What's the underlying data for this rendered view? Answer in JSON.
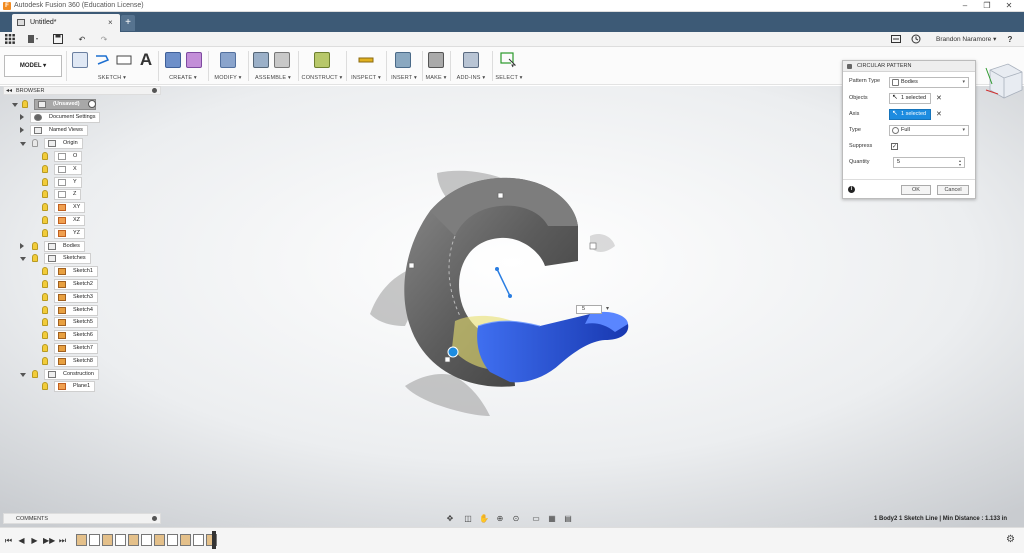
{
  "window": {
    "title": "Autodesk Fusion 360 (Education License)",
    "logo": "F",
    "controls": [
      "–",
      "❐",
      "✕"
    ]
  },
  "tab": {
    "label": "Untitled*",
    "close": "×",
    "plus": "+"
  },
  "qat": {
    "undo": "↶",
    "redo": "↷",
    "save": "💾",
    "user": "Brandon Naramore ▾",
    "help": "?"
  },
  "toolbar": {
    "model_label": "MODEL ▾",
    "groups": [
      "SKETCH ▾",
      "CREATE ▾",
      "MODIFY ▾",
      "ASSEMBLE ▾",
      "CONSTRUCT ▾",
      "INSPECT ▾",
      "INSERT ▾",
      "MAKE ▾",
      "ADD-INS ▾",
      "SELECT ▾"
    ]
  },
  "browser": {
    "title": "BROWSER",
    "root": "(Unsaved)",
    "items": {
      "document_settings": "Document Settings",
      "named_views": "Named Views",
      "origin": "Origin",
      "o": "O",
      "x": "X",
      "y": "Y",
      "z": "Z",
      "xy": "XY",
      "xz": "XZ",
      "yz": "YZ",
      "bodies": "Bodies",
      "sketches": "Sketches",
      "sketch1": "Sketch1",
      "sketch2": "Sketch2",
      "sketch3": "Sketch3",
      "sketch4": "Sketch4",
      "sketch5": "Sketch5",
      "sketch6": "Sketch6",
      "sketch7": "Sketch7",
      "sketch8": "Sketch8",
      "construction": "Construction",
      "plane1": "Plane1"
    }
  },
  "comments": {
    "title": "COMMENTS"
  },
  "dialog": {
    "title": "CIRCULAR PATTERN",
    "pattern_type_label": "Pattern Type",
    "pattern_type_value": "Bodies",
    "objects_label": "Objects",
    "objects_value": "1 selected",
    "axis_label": "Axis",
    "axis_value": "1 selected",
    "type_label": "Type",
    "type_value": "Full",
    "suppress_label": "Suppress",
    "suppress_checked": "✓",
    "quantity_label": "Quantity",
    "quantity_value": "5",
    "info": "i",
    "ok": "OK",
    "cancel": "Cancel"
  },
  "canvas": {
    "quantity_input": "5"
  },
  "status": {
    "text": "1 Body2 1 Sketch Line | Min Distance : 1.133 in"
  },
  "timeline": {
    "controls": [
      "⏮",
      "◀",
      "▶",
      "▶▶",
      "⏭"
    ],
    "settings": "⚙"
  },
  "colors": {
    "tabbar": "#3d5a76",
    "selection_blue": "#1d8ce0",
    "body_blue": "#1f4fd6",
    "body_gray": "#5a5a5a"
  }
}
